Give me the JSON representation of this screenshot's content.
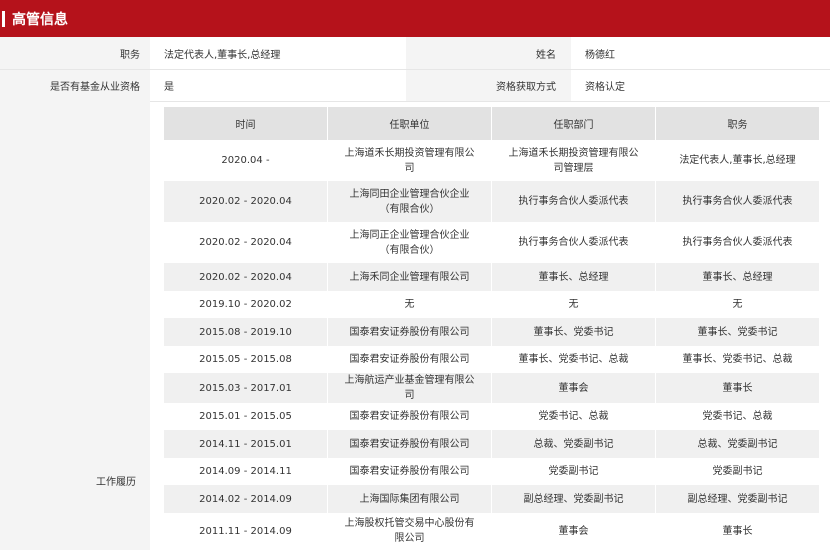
{
  "header": {
    "title": "高管信息"
  },
  "info": {
    "position_label": "职务",
    "position_value": "法定代表人,董事长,总经理",
    "name_label": "姓名",
    "name_value": "杨德红",
    "fund_label": "是否有基金从业资格",
    "fund_value": "是",
    "qual_label": "资格获取方式",
    "qual_value": "资格认定",
    "history_label": "工作履历"
  },
  "history": {
    "columns": [
      "时间",
      "任职单位",
      "任职部门",
      "职务"
    ],
    "rows": [
      [
        "2020.04 -",
        "上海道禾长期投资管理有限公司",
        "上海道禾长期投资管理有限公司管理层",
        "法定代表人,董事长,总经理"
      ],
      [
        "2020.02 - 2020.04",
        "上海同田企业管理合伙企业（有限合伙）",
        "执行事务合伙人委派代表",
        "执行事务合伙人委派代表"
      ],
      [
        "2020.02 - 2020.04",
        "上海同正企业管理合伙企业（有限合伙）",
        "执行事务合伙人委派代表",
        "执行事务合伙人委派代表"
      ],
      [
        "2020.02 - 2020.04",
        "上海禾同企业管理有限公司",
        "董事长、总经理",
        "董事长、总经理"
      ],
      [
        "2019.10 - 2020.02",
        "无",
        "无",
        "无"
      ],
      [
        "2015.08 - 2019.10",
        "国泰君安证券股份有限公司",
        "董事长、党委书记",
        "董事长、党委书记"
      ],
      [
        "2015.05 - 2015.08",
        "国泰君安证券股份有限公司",
        "董事长、党委书记、总裁",
        "董事长、党委书记、总裁"
      ],
      [
        "2015.03 - 2017.01",
        "上海航运产业基金管理有限公司",
        "董事会",
        "董事长"
      ],
      [
        "2015.01 - 2015.05",
        "国泰君安证券股份有限公司",
        "党委书记、总裁",
        "党委书记、总裁"
      ],
      [
        "2014.11 - 2015.01",
        "国泰君安证券股份有限公司",
        "总裁、党委副书记",
        "总裁、党委副书记"
      ],
      [
        "2014.09 - 2014.11",
        "国泰君安证券股份有限公司",
        "党委副书记",
        "党委副书记"
      ],
      [
        "2014.02 - 2014.09",
        "上海国际集团有限公司",
        "副总经理、党委副书记",
        "副总经理、党委副书记"
      ],
      [
        "2011.11 - 2014.09",
        "上海股权托管交易中心股份有限公司",
        "董事会",
        "董事长"
      ]
    ]
  }
}
